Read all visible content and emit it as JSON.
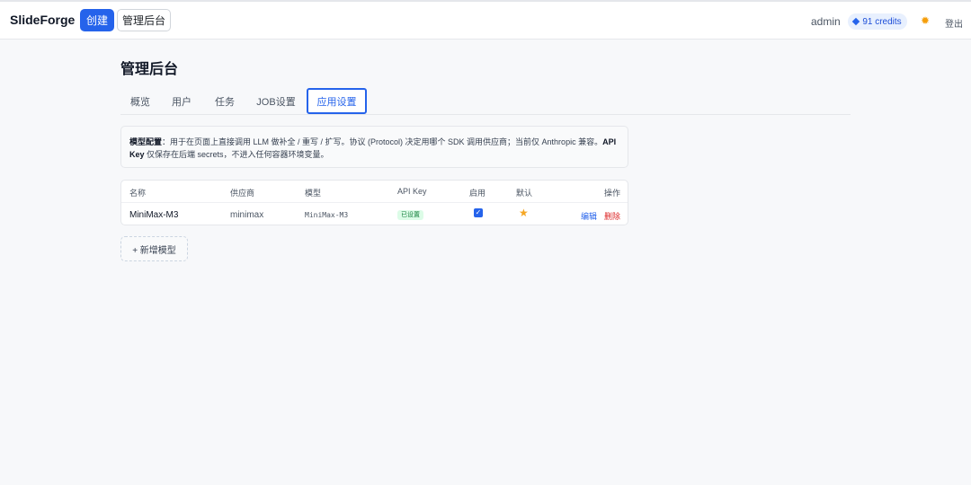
{
  "header": {
    "brand": "SlideForge",
    "create_label": "创建",
    "admin_label": "管理后台",
    "user": "admin",
    "credits": "91 credits",
    "theme_icon": "sun-icon",
    "logout_label": "登出"
  },
  "page": {
    "title": "管理后台"
  },
  "tabs": [
    {
      "label": "概览"
    },
    {
      "label": "用户"
    },
    {
      "label": "任务"
    },
    {
      "label": "JOB设置"
    },
    {
      "label": "应用设置",
      "active": true
    }
  ],
  "info": {
    "bold1": "模型配置",
    "text1": "：用于在页面上直接调用 LLM 做补全 / 重写 / 扩写。协议 (Protocol) 决定用哪个 SDK 调用供应商；当前仅 Anthropic 兼容。",
    "bold2": "API Key",
    "text2": " 仅保存在后端 secrets，不进入任何容器环境变量。"
  },
  "table": {
    "headers": {
      "name": "名称",
      "provider": "供应商",
      "model": "模型",
      "api_key": "API Key",
      "enabled": "启用",
      "default": "默认",
      "actions": "操作"
    },
    "rows": [
      {
        "name": "MiniMax-M3",
        "provider": "minimax",
        "model": "MiniMax-M3",
        "api_key_status": "已设置",
        "enabled": true,
        "default": true,
        "edit": "编辑",
        "delete": "删除"
      }
    ]
  },
  "add_button": "+ 新增模型",
  "colors": {
    "accent": "#2563eb",
    "danger": "#dc2626",
    "star": "#f5a623",
    "badge_bg": "#dcfce7"
  }
}
